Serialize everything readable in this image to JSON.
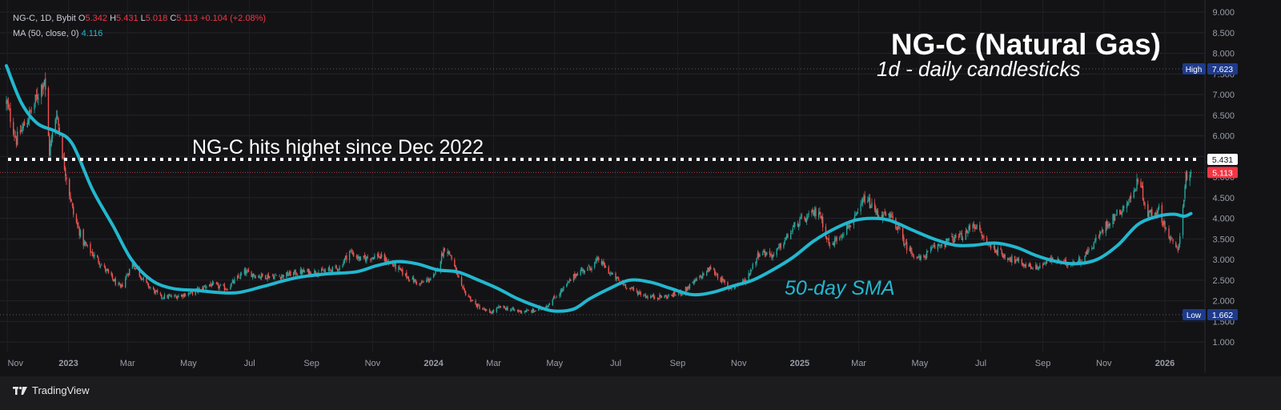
{
  "legend": {
    "symbol": "NG-C, 1D, Bybit",
    "open_label": "O",
    "open": "5.342",
    "high_label": "H",
    "high": "5.431",
    "low_label": "L",
    "low": "5.018",
    "close_label": "C",
    "close": "5.113",
    "change": "+0.104 (+2.08%)",
    "ma_label": "MA (50, close, 0)",
    "ma_value": "4.116"
  },
  "footer": {
    "brand": "TradingView"
  },
  "colors": {
    "background": "#131316",
    "up": "#26a69a",
    "down": "#ef5350",
    "ma": "#22b8cf",
    "high_low_badge": "#1e3a8a",
    "last_price_badge": "#f23645"
  },
  "chart_data": {
    "type": "candlestick",
    "title": "NG-C (Natural Gas)",
    "subtitle": "1d - daily candlesticks",
    "annotations": {
      "resistance_text": "NG-C hits highet since Dec 2022",
      "resistance_level": 5.431,
      "ma_text": "50-day SMA"
    },
    "x_ticks": [
      "Nov",
      "2023",
      "Mar",
      "May",
      "Jul",
      "Sep",
      "Nov",
      "2024",
      "Mar",
      "May",
      "Jul",
      "Sep",
      "Nov",
      "2025",
      "Mar",
      "May",
      "Jul",
      "Sep",
      "Nov",
      "2026"
    ],
    "y_ticks": [
      "9.000",
      "8.500",
      "8.000",
      "7.500",
      "7.000",
      "6.500",
      "6.000",
      "5.500",
      "5.000",
      "4.500",
      "4.000",
      "3.500",
      "3.000",
      "2.500",
      "2.000",
      "1.500",
      "1.000"
    ],
    "ylim": [
      0.75,
      9.1
    ],
    "xlim": [
      "2022-10-31",
      "2026-02-10"
    ],
    "price_marks": {
      "high": {
        "label": "High",
        "value": "7.623"
      },
      "low": {
        "label": "Low",
        "value": "1.662"
      },
      "resistance": {
        "value": "5.431"
      },
      "last": {
        "value": "5.113"
      }
    },
    "price_anchors": [
      [
        "2022-10-31",
        6.8
      ],
      [
        "2022-11-10",
        5.9
      ],
      [
        "2022-11-25",
        6.6
      ],
      [
        "2022-12-08",
        7.4
      ],
      [
        "2022-12-13",
        5.6
      ],
      [
        "2022-12-20",
        6.6
      ],
      [
        "2022-12-27",
        5.4
      ],
      [
        "2023-01-06",
        4.1
      ],
      [
        "2023-01-16",
        3.4
      ],
      [
        "2023-01-30",
        3.0
      ],
      [
        "2023-02-15",
        2.5
      ],
      [
        "2023-02-22",
        2.3
      ],
      [
        "2023-03-06",
        2.9
      ],
      [
        "2023-03-20",
        2.4
      ],
      [
        "2023-04-03",
        2.1
      ],
      [
        "2023-04-17",
        2.1
      ],
      [
        "2023-05-05",
        2.2
      ],
      [
        "2023-05-22",
        2.4
      ],
      [
        "2023-06-08",
        2.3
      ],
      [
        "2023-06-26",
        2.7
      ],
      [
        "2023-07-10",
        2.6
      ],
      [
        "2023-08-01",
        2.6
      ],
      [
        "2023-08-21",
        2.7
      ],
      [
        "2023-09-11",
        2.7
      ],
      [
        "2023-09-29",
        2.8
      ],
      [
        "2023-10-09",
        3.2
      ],
      [
        "2023-10-20",
        3.0
      ],
      [
        "2023-11-06",
        3.1
      ],
      [
        "2023-11-20",
        2.9
      ],
      [
        "2023-12-05",
        2.6
      ],
      [
        "2023-12-18",
        2.4
      ],
      [
        "2024-01-02",
        2.6
      ],
      [
        "2024-01-12",
        3.3
      ],
      [
        "2024-01-18",
        3.1
      ],
      [
        "2024-01-29",
        2.3
      ],
      [
        "2024-02-12",
        1.9
      ],
      [
        "2024-02-26",
        1.7
      ],
      [
        "2024-03-08",
        1.85
      ],
      [
        "2024-03-25",
        1.75
      ],
      [
        "2024-04-10",
        1.75
      ],
      [
        "2024-04-24",
        1.9
      ],
      [
        "2024-05-10",
        2.3
      ],
      [
        "2024-05-24",
        2.7
      ],
      [
        "2024-06-05",
        2.8
      ],
      [
        "2024-06-14",
        3.0
      ],
      [
        "2024-06-28",
        2.6
      ],
      [
        "2024-07-15",
        2.3
      ],
      [
        "2024-08-02",
        2.1
      ],
      [
        "2024-08-20",
        2.1
      ],
      [
        "2024-09-05",
        2.2
      ],
      [
        "2024-09-20",
        2.5
      ],
      [
        "2024-10-04",
        2.8
      ],
      [
        "2024-10-22",
        2.3
      ],
      [
        "2024-11-08",
        2.5
      ],
      [
        "2024-11-22",
        3.2
      ],
      [
        "2024-12-06",
        3.1
      ],
      [
        "2024-12-18",
        3.5
      ],
      [
        "2024-12-30",
        3.9
      ],
      [
        "2025-01-08",
        4.0
      ],
      [
        "2025-01-20",
        4.2
      ],
      [
        "2025-01-31",
        3.3
      ],
      [
        "2025-02-10",
        3.6
      ],
      [
        "2025-02-26",
        4.0
      ],
      [
        "2025-03-07",
        4.5
      ],
      [
        "2025-03-20",
        4.1
      ],
      [
        "2025-04-04",
        4.0
      ],
      [
        "2025-04-18",
        3.3
      ],
      [
        "2025-05-01",
        3.0
      ],
      [
        "2025-05-16",
        3.3
      ],
      [
        "2025-06-03",
        3.5
      ],
      [
        "2025-06-16",
        3.6
      ],
      [
        "2025-06-23",
        3.9
      ],
      [
        "2025-07-07",
        3.4
      ],
      [
        "2025-07-24",
        3.1
      ],
      [
        "2025-08-11",
        2.9
      ],
      [
        "2025-08-25",
        2.8
      ],
      [
        "2025-09-10",
        3.0
      ],
      [
        "2025-09-25",
        2.9
      ],
      [
        "2025-10-10",
        3.0
      ],
      [
        "2025-10-22",
        3.4
      ],
      [
        "2025-11-05",
        3.9
      ],
      [
        "2025-11-18",
        4.2
      ],
      [
        "2025-12-01",
        4.6
      ],
      [
        "2025-12-05",
        5.0
      ],
      [
        "2025-12-15",
        4.1
      ],
      [
        "2025-12-26",
        4.2
      ],
      [
        "2026-01-06",
        3.5
      ],
      [
        "2026-01-14",
        3.2
      ],
      [
        "2026-01-22",
        5.0
      ],
      [
        "2026-01-27",
        5.113
      ]
    ],
    "ma_anchors": [
      [
        "2022-10-31",
        7.7
      ],
      [
        "2022-11-15",
        6.8
      ],
      [
        "2022-12-01",
        6.3
      ],
      [
        "2022-12-20",
        6.1
      ],
      [
        "2023-01-05",
        5.8
      ],
      [
        "2023-01-25",
        4.7
      ],
      [
        "2023-02-15",
        3.8
      ],
      [
        "2023-03-05",
        3.0
      ],
      [
        "2023-03-25",
        2.5
      ],
      [
        "2023-04-15",
        2.3
      ],
      [
        "2023-05-10",
        2.25
      ],
      [
        "2023-06-01",
        2.2
      ],
      [
        "2023-06-20",
        2.2
      ],
      [
        "2023-07-15",
        2.35
      ],
      [
        "2023-08-15",
        2.55
      ],
      [
        "2023-09-15",
        2.65
      ],
      [
        "2023-10-15",
        2.7
      ],
      [
        "2023-11-05",
        2.85
      ],
      [
        "2023-11-25",
        2.95
      ],
      [
        "2023-12-15",
        2.9
      ],
      [
        "2024-01-05",
        2.75
      ],
      [
        "2024-01-25",
        2.7
      ],
      [
        "2024-02-15",
        2.5
      ],
      [
        "2024-03-05",
        2.3
      ],
      [
        "2024-03-25",
        2.05
      ],
      [
        "2024-04-15",
        1.85
      ],
      [
        "2024-05-01",
        1.75
      ],
      [
        "2024-05-20",
        1.8
      ],
      [
        "2024-06-05",
        2.05
      ],
      [
        "2024-06-25",
        2.3
      ],
      [
        "2024-07-15",
        2.5
      ],
      [
        "2024-08-05",
        2.45
      ],
      [
        "2024-08-25",
        2.3
      ],
      [
        "2024-09-15",
        2.15
      ],
      [
        "2024-10-05",
        2.2
      ],
      [
        "2024-10-25",
        2.35
      ],
      [
        "2024-11-15",
        2.5
      ],
      [
        "2024-12-05",
        2.75
      ],
      [
        "2024-12-25",
        3.05
      ],
      [
        "2025-01-15",
        3.45
      ],
      [
        "2025-02-05",
        3.75
      ],
      [
        "2025-02-25",
        3.95
      ],
      [
        "2025-03-15",
        4.0
      ],
      [
        "2025-04-01",
        3.95
      ],
      [
        "2025-04-25",
        3.7
      ],
      [
        "2025-05-15",
        3.5
      ],
      [
        "2025-06-05",
        3.35
      ],
      [
        "2025-06-25",
        3.35
      ],
      [
        "2025-07-15",
        3.4
      ],
      [
        "2025-08-05",
        3.3
      ],
      [
        "2025-08-25",
        3.1
      ],
      [
        "2025-09-15",
        2.95
      ],
      [
        "2025-10-05",
        2.9
      ],
      [
        "2025-10-25",
        3.0
      ],
      [
        "2025-11-15",
        3.35
      ],
      [
        "2025-12-05",
        3.85
      ],
      [
        "2025-12-25",
        4.05
      ],
      [
        "2026-01-10",
        4.1
      ],
      [
        "2026-01-20",
        4.05
      ],
      [
        "2026-01-27",
        4.116
      ]
    ]
  }
}
